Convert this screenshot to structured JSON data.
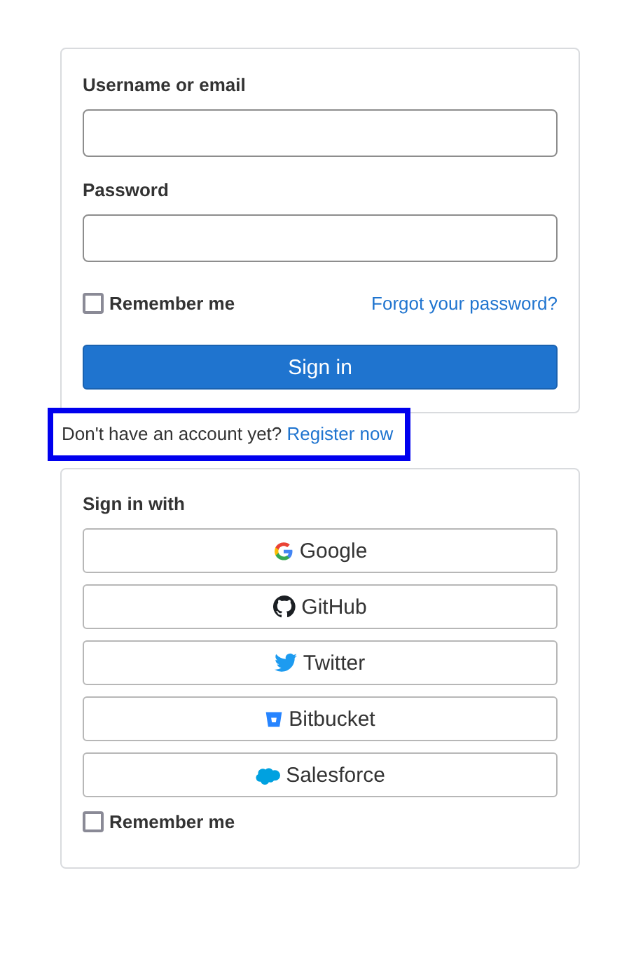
{
  "login_form": {
    "fields": [
      {
        "label": "Username or email"
      },
      {
        "label": "Password"
      }
    ],
    "remember_me": {
      "label": "Remember me",
      "checked": false
    },
    "forgot_link": "Forgot your password?",
    "submit": "Sign in"
  },
  "register_prompt": {
    "text": "Don't have an account yet?",
    "link": "Register now",
    "highlighted": true
  },
  "social_login": {
    "title": "Sign in with",
    "providers": [
      {
        "kind": "google",
        "label": "Google"
      },
      {
        "kind": "github",
        "label": "GitHub"
      },
      {
        "kind": "twitter",
        "label": "Twitter"
      },
      {
        "kind": "bitbucket",
        "label": "Bitbucket"
      },
      {
        "kind": "salesforce",
        "label": "Salesforce"
      }
    ],
    "remember_me": {
      "label": "Remember me",
      "checked": false
    }
  }
}
